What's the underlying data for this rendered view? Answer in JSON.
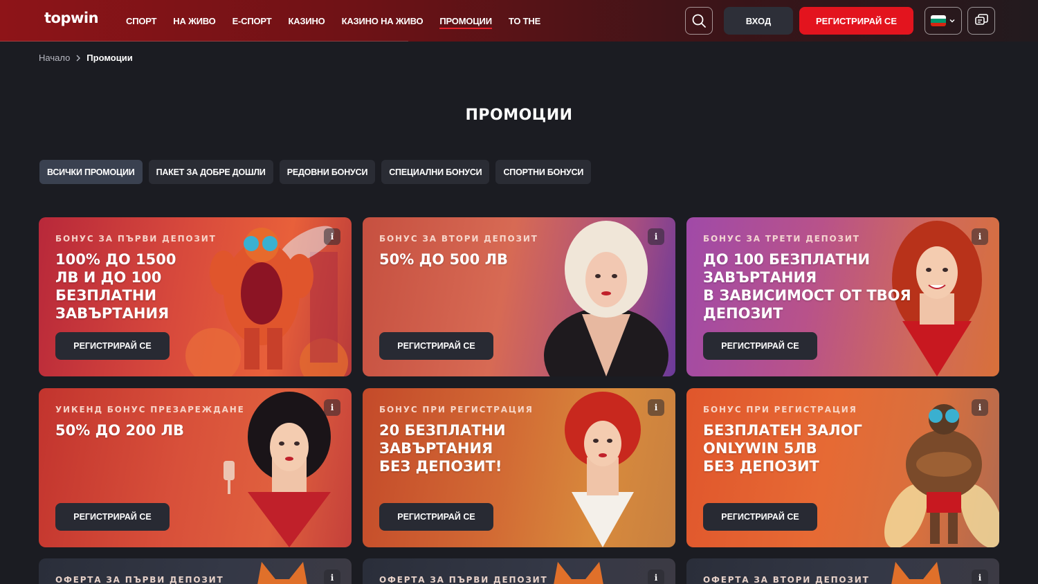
{
  "header": {
    "logo": "topwin",
    "nav": [
      "СПОРТ",
      "НА ЖИВО",
      "Е-СПОРТ",
      "КАЗИНО",
      "КАЗИНО НА ЖИВО",
      "ПРОМОЦИИ",
      "TO THE"
    ],
    "active_nav": "ПРОМОЦИИ",
    "login_label": "ВХОД",
    "register_label": "РЕГИСТРИРАЙ СЕ"
  },
  "breadcrumb": {
    "home": "Начало",
    "current": "Промоции"
  },
  "page_title": "ПРОМОЦИИ",
  "filters": [
    "ВСИЧКИ ПРОМОЦИИ",
    "ПАКЕТ ЗА ДОБРЕ ДОШЛИ",
    "РЕДОВНИ БОНУСИ",
    "СПЕЦИАЛНИ БОНУСИ",
    "СПОРТНИ БОНУСИ"
  ],
  "active_filter": "ВСИЧКИ ПРОМОЦИИ",
  "cards": [
    {
      "tag": "БОНУС ЗА ПЪРВИ ДЕПОЗИТ",
      "title": "100% ДО 1500\nЛВ И ДО 100\nБЕЗПЛАТНИ\nЗАВЪРТАНИЯ",
      "button": "РЕГИСТРИРАЙ СЕ",
      "info": "i",
      "art": "fly-mascot"
    },
    {
      "tag": "БОНУС ЗА ВТОРИ ДЕПОЗИТ",
      "title": "50% ДО 500 ЛВ",
      "button": "РЕГИСТРИРАЙ СЕ",
      "info": "i",
      "art": "blonde-woman"
    },
    {
      "tag": "БОНУС ЗА ТРЕТИ ДЕПОЗИТ",
      "title": "ДО 100 БЕЗПЛАТНИ\nЗАВЪРТАНИЯ\nВ ЗАВИСИМОСТ ОТ ТВОЯ\nДЕПОЗИТ",
      "button": "РЕГИСТРИРАЙ СЕ",
      "info": "i",
      "art": "redhead-woman"
    },
    {
      "tag": "УИКЕНД БОНУС ПРЕЗАРЕЖДАНЕ",
      "title": "50% ДО 200 ЛВ",
      "button": "РЕГИСТРИРАЙ СЕ",
      "info": "i",
      "art": "dark-hair-woman"
    },
    {
      "tag": "БОНУС ПРИ РЕГИСТРАЦИЯ",
      "title": "20 БЕЗПЛАТНИ\nЗАВЪРТАНИЯ\nБЕЗ ДЕПОЗИТ!",
      "button": "РЕГИСТРИРАЙ СЕ",
      "info": "i",
      "art": "red-hair-woman"
    },
    {
      "tag": "БОНУС ПРИ РЕГИСТРАЦИЯ",
      "title": "БЕЗПЛАТЕН ЗАЛОГ\nONLYWIN 5ЛВ\nБЕЗ ДЕПОЗИТ",
      "button": "РЕГИСТРИРАЙ СЕ",
      "info": "i",
      "art": "fly-mascot"
    },
    {
      "tag": "ОФЕРТА ЗА ПЪРВИ ДЕПОЗИТ",
      "title": "",
      "button": "",
      "info": "i",
      "art": "fox"
    },
    {
      "tag": "ОФЕРТА ЗА ПЪРВИ ДЕПОЗИТ",
      "title": "",
      "button": "",
      "info": "i",
      "art": "fox"
    },
    {
      "tag": "ОФЕРТА ЗА ВТОРИ ДЕПОЗИТ",
      "title": "",
      "button": "",
      "info": "i",
      "art": "fox"
    }
  ],
  "colors": {
    "accent": "#e3141e",
    "background": "#1b1c22",
    "chip": "#2a2c34"
  }
}
